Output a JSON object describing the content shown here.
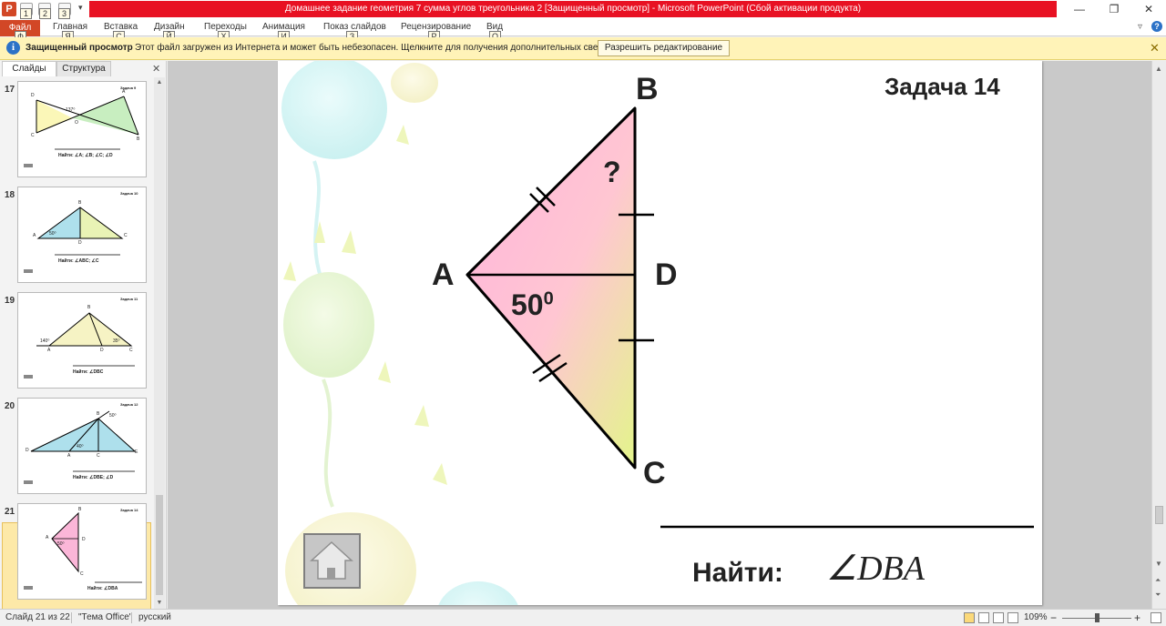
{
  "titlebar": {
    "app_icon": "P",
    "title": "Домашнее задание геометрия 7 сумма углов треугольника 2 [Защищенный просмотр]  -  Microsoft PowerPoint (Сбой активации продукта)",
    "keytips": [
      "1",
      "2",
      "3"
    ],
    "minimize": "—",
    "restore": "❐",
    "close": "✕"
  },
  "ribbon": {
    "file_tab": "Файл",
    "tabs": [
      "Главная",
      "Вставка",
      "Дизайн",
      "Переходы",
      "Анимация",
      "Показ слайдов",
      "Рецензирование",
      "Вид"
    ],
    "keytips": [
      "Ф",
      "Я",
      "С",
      "Й",
      "Х",
      "И",
      "З",
      "Р",
      "О"
    ],
    "help": "?",
    "collapse": "▿"
  },
  "protected_bar": {
    "icon": "i",
    "title": "Защищенный просмотр",
    "message": "Этот файл загружен из Интернета и может быть небезопасен. Щелкните для получения дополнительных сведений.",
    "button": "Разрешить редактирование",
    "close": "✕"
  },
  "left_panel": {
    "tabs": [
      "Слайды",
      "Структура"
    ],
    "close": "✕",
    "thumbnails": [
      {
        "number": "17",
        "task": "Задача 9",
        "find": "Найти: ∠A; ∠B; ∠C; ∠D",
        "labels": [
          "D",
          "A",
          "C",
          "B",
          "O"
        ],
        "angle": "137⁰"
      },
      {
        "number": "18",
        "task": "Задача 10",
        "find": "Найти:   ∠ABC; ∠C",
        "labels": [
          "A",
          "B",
          "C",
          "D"
        ],
        "angle": "50⁰"
      },
      {
        "number": "19",
        "task": "Задача 11",
        "find": "Найти:  ∠DBC",
        "labels": [
          "A",
          "B",
          "C",
          "D"
        ],
        "angle": "140⁰",
        "angle2": "35⁰"
      },
      {
        "number": "20",
        "task": "Задача 12",
        "find": "Найти:  ∠DBE; ∠D",
        "labels": [
          "D",
          "A",
          "B",
          "C",
          "E"
        ],
        "angle": "40⁰",
        "angle2": "50⁰"
      },
      {
        "number": "21",
        "task": "Задача 14",
        "find": "Найти:       ∠DBA",
        "labels": [
          "A",
          "B",
          "C",
          "D"
        ],
        "angle": "50⁰",
        "selected": true
      }
    ]
  },
  "slide": {
    "task_title": "Задача 14",
    "vertex_labels": {
      "A": "A",
      "B": "B",
      "C": "C",
      "D": "D"
    },
    "unknown_angle": "?",
    "given_angle_value": "50",
    "given_angle_degree": "0",
    "find_label": "Найти:",
    "find_expression": "∠DBA",
    "home_icon": "home-icon"
  },
  "statusbar": {
    "slide_info": "Слайд 21 из 22",
    "theme": "\"Тема Office\"",
    "language": "русский",
    "zoom": "109%",
    "zoom_out": "−",
    "zoom_in": "+"
  },
  "colors": {
    "accent": "#d24726",
    "title_red": "#e81123",
    "protected_bar": "#fff3b8",
    "triangle_pink": "#ffb3dc",
    "triangle_yellow": "#e3f58a"
  }
}
